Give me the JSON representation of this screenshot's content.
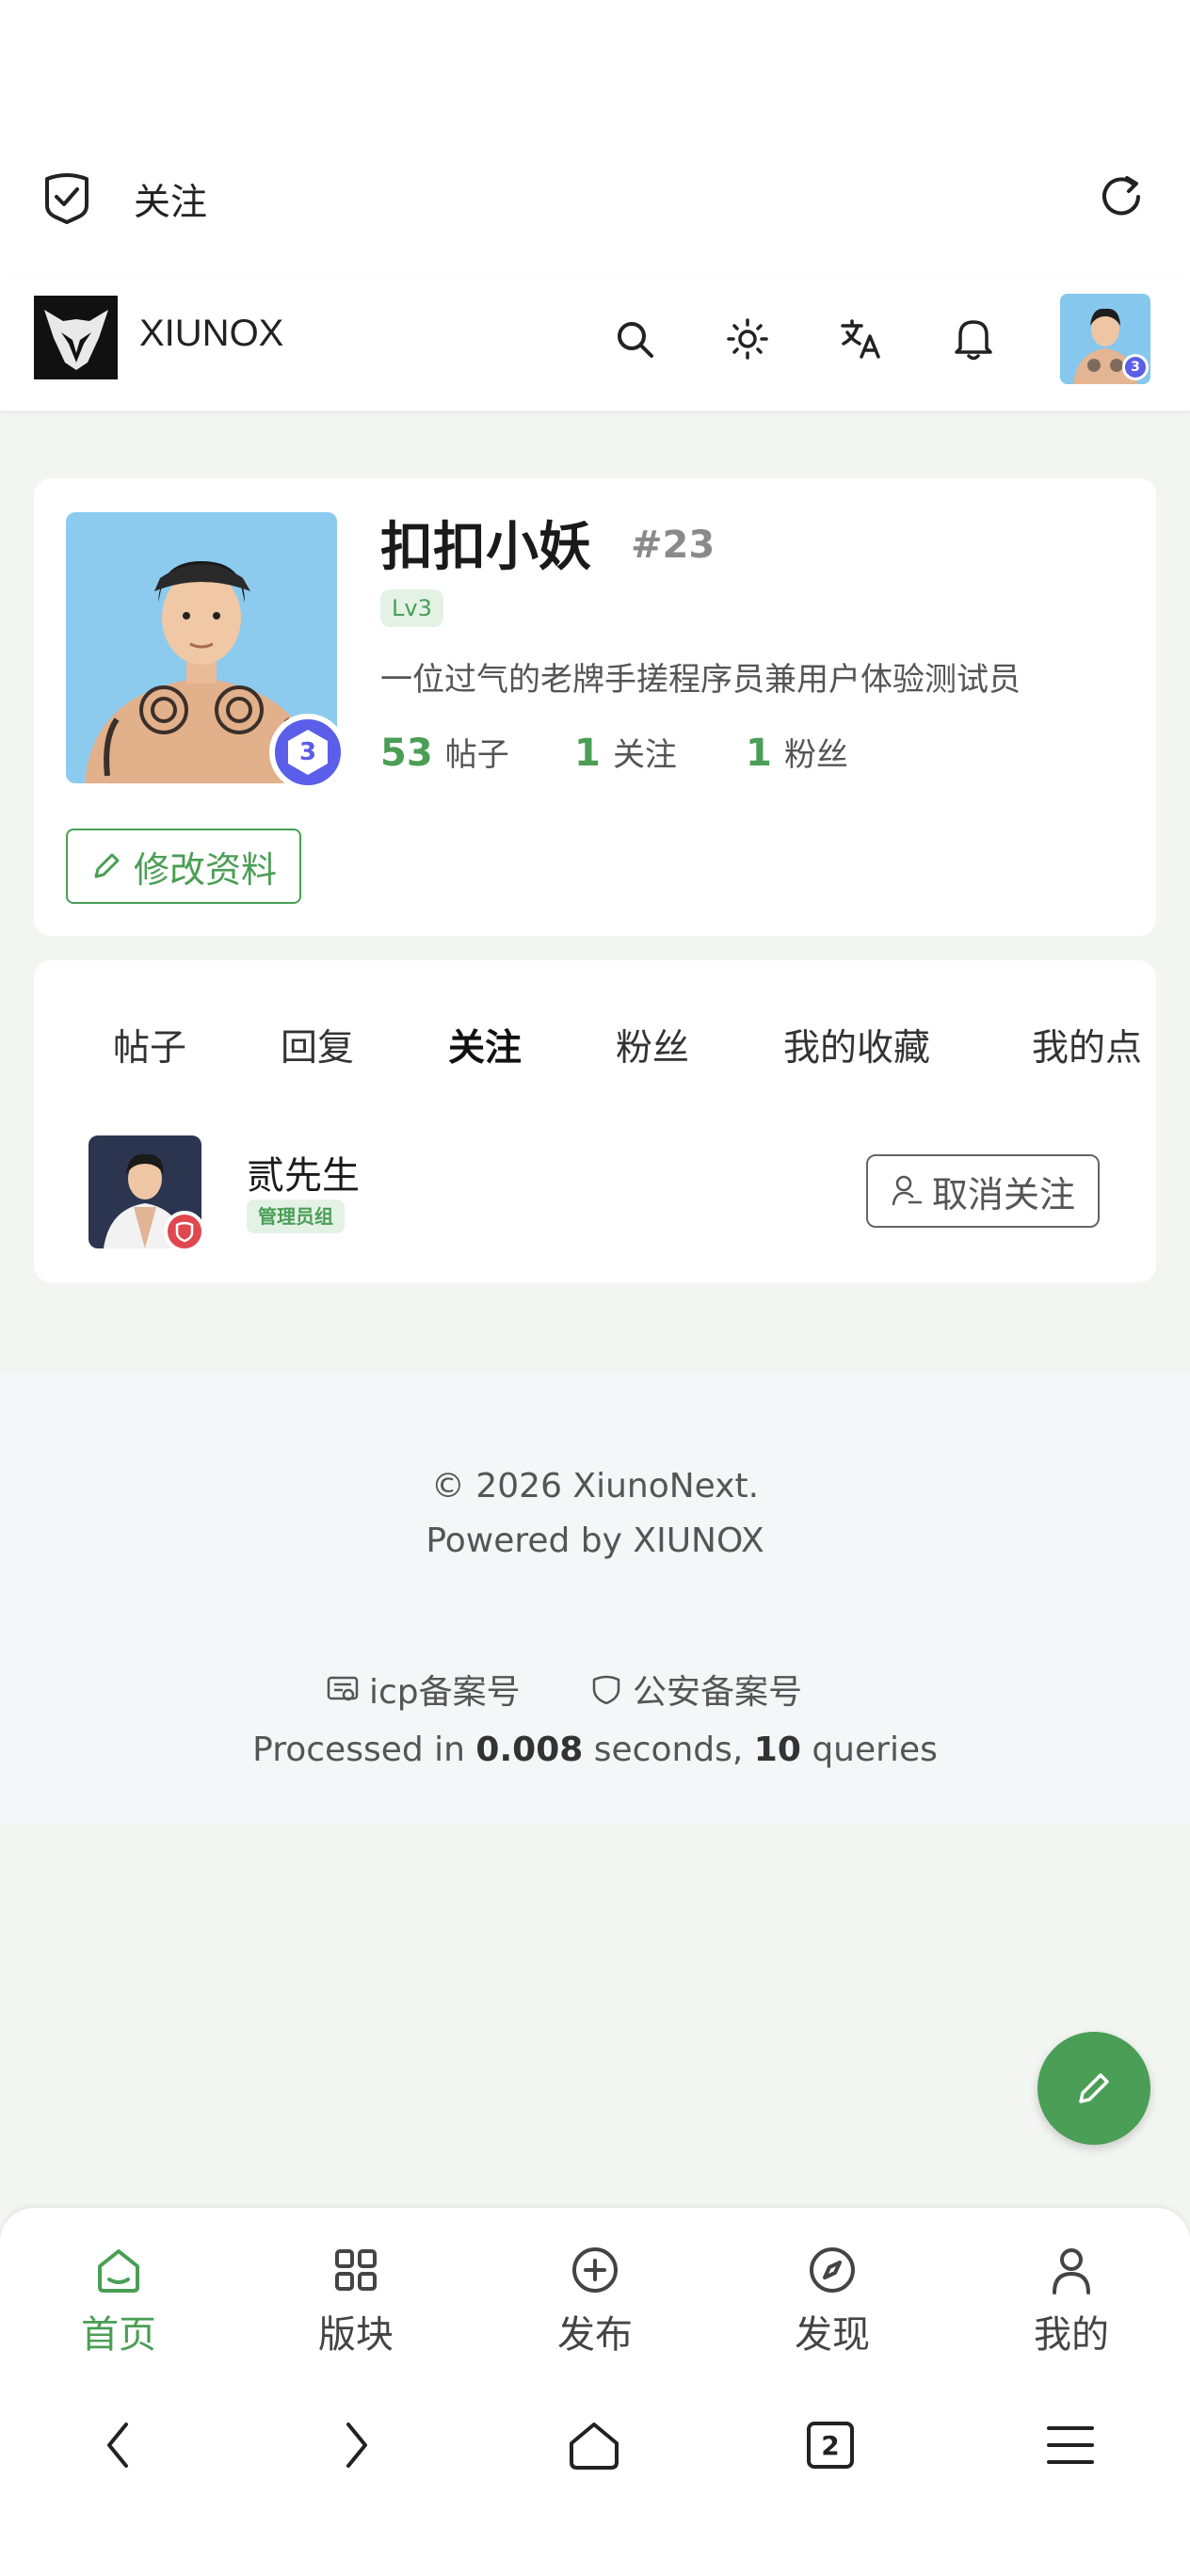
{
  "browser": {
    "page_title": "关注"
  },
  "header": {
    "site_name": "XIUNOX",
    "avatar_badge": "3"
  },
  "profile": {
    "username": "扣扣小妖",
    "user_id": "#23",
    "level": "Lv3",
    "bio": "一位过气的老牌手搓程序员兼用户体验测试员",
    "avatar_badge": "3",
    "stats": [
      {
        "value": "53",
        "label": "帖子"
      },
      {
        "value": "1",
        "label": "关注"
      },
      {
        "value": "1",
        "label": "粉丝"
      }
    ],
    "edit_label": "修改资料"
  },
  "tabs": [
    "帖子",
    "回复",
    "关注",
    "粉丝",
    "我的收藏",
    "我的点"
  ],
  "active_tab": "关注",
  "following": [
    {
      "name": "贰先生",
      "role": "管理员组",
      "action": "取消关注"
    }
  ],
  "footer": {
    "copyright": "© 2026 XiunoNext.",
    "powered": "Powered by XIUNOX",
    "icp": "icp备案号",
    "police": "公安备案号",
    "processed_prefix": "Processed in ",
    "seconds": "0.008",
    "seconds_suffix": " seconds, ",
    "queries": "10",
    "queries_suffix": " queries"
  },
  "bottom_nav": [
    {
      "label": "首页",
      "icon": "home-icon",
      "active": true
    },
    {
      "label": "版块",
      "icon": "grid-icon",
      "active": false
    },
    {
      "label": "发布",
      "icon": "plus-circle-icon",
      "active": false
    },
    {
      "label": "发现",
      "icon": "compass-icon",
      "active": false
    },
    {
      "label": "我的",
      "icon": "user-icon",
      "active": false
    }
  ],
  "system_nav": {
    "tab_count": "2"
  },
  "colors": {
    "accent": "#4a9e55",
    "badge": "#5b5ee8",
    "danger": "#e0474f"
  }
}
